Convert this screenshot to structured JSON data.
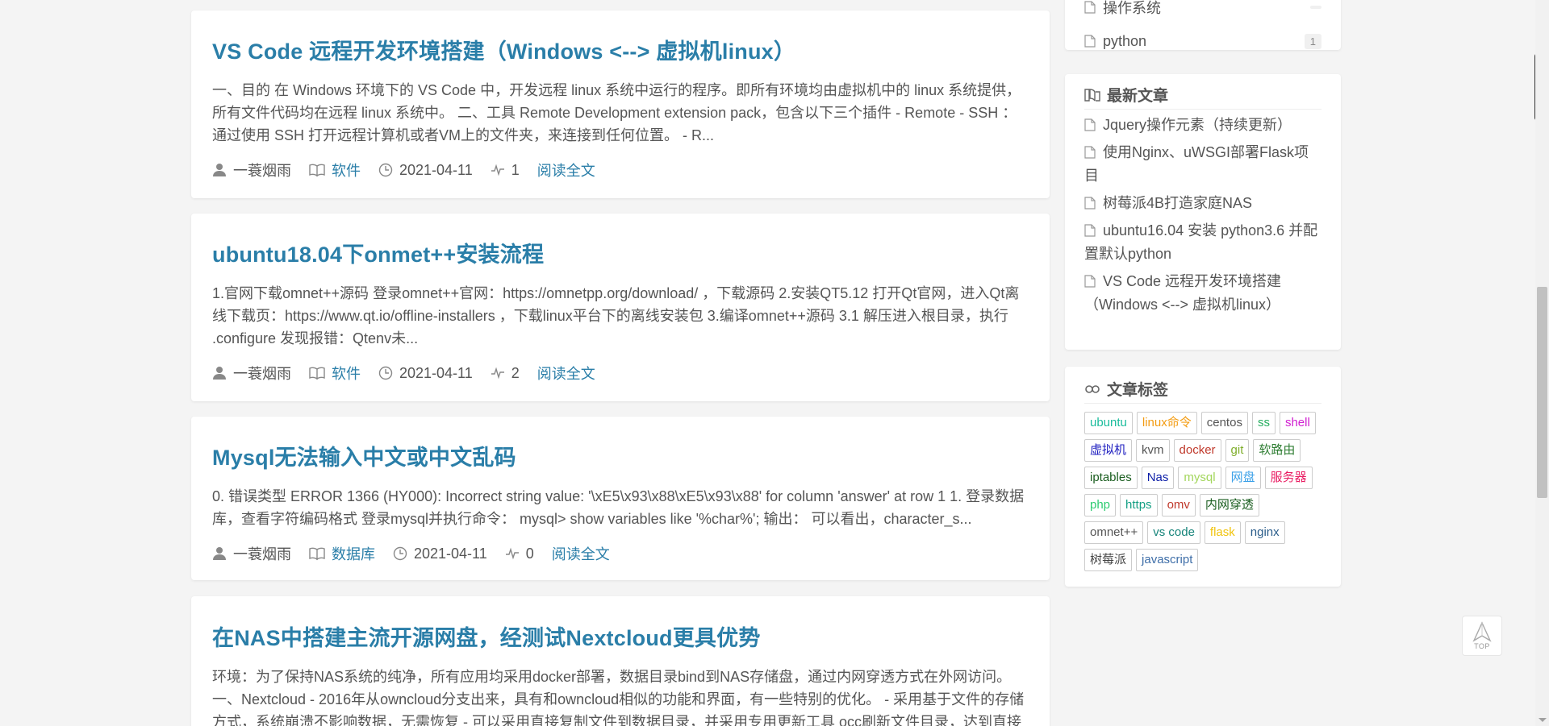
{
  "posts": [
    {
      "title": "VS Code 远程开发环境搭建（Windows <--> 虚拟机linux）",
      "excerpt": "一、目的 在 Windows 环境下的 VS Code 中，开发远程 linux 系统中运行的程序。即所有环境均由虚拟机中的 linux 系统提供，所有文件代码均在远程 linux 系统中。 二、工具 Remote Development extension pack，包含以下三个插件 - Remote - SSH ： 通过使用 SSH 打开远程计算机或者VM上的文件夹，来连接到任何位置。 - R...",
      "author": "一蓑烟雨",
      "category": "软件",
      "date": "2021-04-11",
      "views": "1",
      "read_more": "阅读全文"
    },
    {
      "title": "ubuntu18.04下onmet++安装流程",
      "excerpt": "1.官网下载omnet++源码 登录omnet++官网：https://omnetpp.org/download/ ，下载源码 2.安装QT5.12 打开Qt官网，进入Qt离线下载页：https://www.qt.io/offline-installers ，下载linux平台下的离线安装包 3.编译omnet++源码 3.1 解压进入根目录，执行 .configure 发现报错：Qtenv未...",
      "author": "一蓑烟雨",
      "category": "软件",
      "date": "2021-04-11",
      "views": "2",
      "read_more": "阅读全文"
    },
    {
      "title": "Mysql无法输入中文或中文乱码",
      "excerpt": "0. 错误类型 ERROR 1366 (HY000): Incorrect string value: '\\xE5\\x93\\x88\\xE5\\x93\\x88' for column 'answer' at row 1 1. 登录数据库，查看字符编码格式 登录mysql并执行命令： mysql> show variables like '%char%'; 输出： 可以看出，character_s...",
      "author": "一蓑烟雨",
      "category": "数据库",
      "date": "2021-04-11",
      "views": "0",
      "read_more": "阅读全文"
    },
    {
      "title": "在NAS中搭建主流开源网盘，经测试Nextcloud更具优势",
      "excerpt": "环境：为了保持NAS系统的纯净，所有应用均采用docker部署，数据目录bind到NAS存储盘，通过内网穿透方式在外网访问。 一、Nextcloud - 2016年从owncloud分支出来，具有和owncloud相似的功能和界面，有一些特别的优化。 - 采用基于文件的存储方式，系统崩溃不影响数据，无需恢复 - 可以采用直接复制文件到数据目录，并采用专用更新工具 occ刷新文件目录，达到直接添加..."
    }
  ],
  "categories_widget": {
    "items": [
      {
        "label": "操作系统",
        "count": ""
      },
      {
        "label": "python",
        "count": "1"
      }
    ]
  },
  "recent_widget": {
    "title": "最新文章",
    "items": [
      "Jquery操作元素（持续更新）",
      "使用Nginx、uWSGI部署Flask项目",
      "树莓派4B打造家庭NAS",
      "ubuntu16.04 安装 python3.6 并配置默认python",
      "VS Code 远程开发环境搭建（Windows <--> 虚拟机linux）"
    ]
  },
  "tags_widget": {
    "title": "文章标签",
    "tags": [
      {
        "label": "ubuntu",
        "color": "#1abc9c"
      },
      {
        "label": "linux命令",
        "color": "#f39c12"
      },
      {
        "label": "centos",
        "color": "#555555"
      },
      {
        "label": "ss",
        "color": "#27ae60"
      },
      {
        "label": "shell",
        "color": "#d01fd0"
      },
      {
        "label": "虚拟机",
        "color": "#2020c0"
      },
      {
        "label": "kvm",
        "color": "#555555"
      },
      {
        "label": "docker",
        "color": "#c0392b"
      },
      {
        "label": "git",
        "color": "#7fae2a"
      },
      {
        "label": "软路由",
        "color": "#2e7d32"
      },
      {
        "label": "iptables",
        "color": "#1b5e20"
      },
      {
        "label": "Nas",
        "color": "#0d1fa8"
      },
      {
        "label": "mysql",
        "color": "#a3d65c"
      },
      {
        "label": "网盘",
        "color": "#3aa0e8"
      },
      {
        "label": "服务器",
        "color": "#e91e63"
      },
      {
        "label": "php",
        "color": "#2ecc71"
      },
      {
        "label": "https",
        "color": "#16a085"
      },
      {
        "label": "omv",
        "color": "#c0392b"
      },
      {
        "label": "内网穿透",
        "color": "#1b5e20"
      },
      {
        "label": "omnet++",
        "color": "#555555"
      },
      {
        "label": "vs code",
        "color": "#16847a"
      },
      {
        "label": "flask",
        "color": "#f1c40f"
      },
      {
        "label": "nginx",
        "color": "#2a5d8a"
      },
      {
        "label": "树莓派",
        "color": "#444444"
      },
      {
        "label": "javascript",
        "color": "#3e6ea8"
      }
    ]
  },
  "back_to_top": {
    "label": "TOP"
  },
  "scroll": {
    "position_fraction": 0.56
  },
  "colors": {
    "accent": "#2a7ea8",
    "background": "#f4f4f4"
  }
}
